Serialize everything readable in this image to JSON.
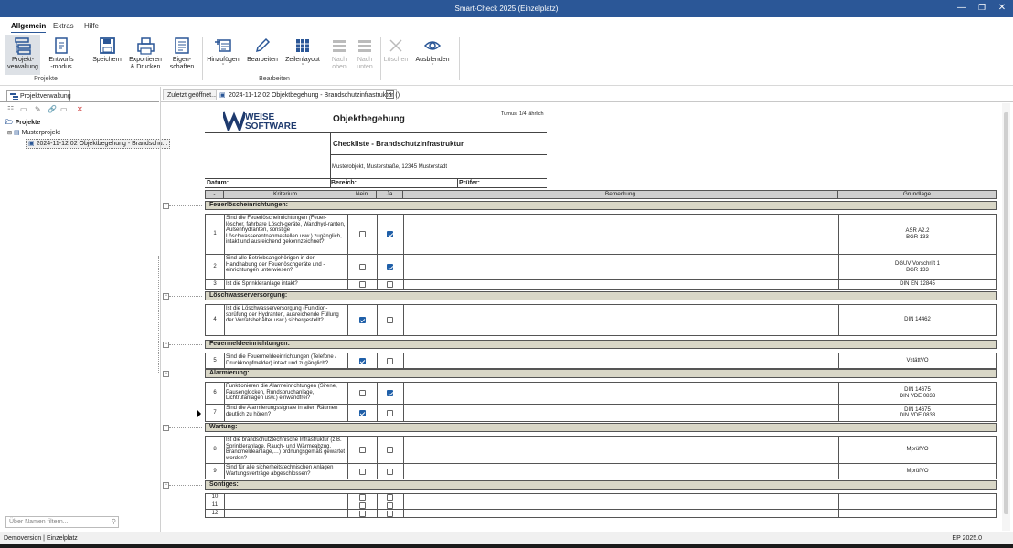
{
  "window": {
    "title": "Smart-Check 2025 (Einzelplatz)"
  },
  "ribbon": {
    "tabs": [
      "Allgemein",
      "Extras",
      "Hilfe"
    ],
    "buttons": {
      "projektverwaltung": "Projekt-\nverwaltung",
      "entwurfsmodus": "Entwurfs\n-modus",
      "speichern": "Speichern",
      "exportieren": "Exportieren\n& Drucken",
      "eigenschaften": "Eigen-\nschaften",
      "hinzufuegen": "Hinzufügen",
      "bearbeiten": "Bearbeiten",
      "zeilenlayout": "Zeilenlayout",
      "nach_oben": "Nach\noben",
      "nach_unten": "Nach\nunten",
      "loeschen": "Löschen",
      "ausblenden": "Ausblenden"
    },
    "groups": {
      "projekte": "Projekte",
      "bearbeiten": "Bearbeiten"
    }
  },
  "left_panel": {
    "tab": "Projektverwaltung",
    "tree": {
      "root": "Projekte",
      "project": "Musterprojekt",
      "item": "2024-11-12 02 Objektbegehung - Brandschu..."
    },
    "filter_placeholder": "Über Namen filtern..."
  },
  "doc_tabs": {
    "recent": "Zuletzt geöffnet...",
    "active": "2024-11-12 02 Objektbegehung - Brandschutzinfrastruktur ()"
  },
  "document": {
    "logo_line1": "WEISE",
    "logo_line2": "SOFTWARE",
    "title": "Objektbegehung",
    "turnus": "Turnus: 1/4 jährlich",
    "checklist": "Checkliste - Brandschutzinfrastruktur",
    "address": "Musterobjekt, Musterstraße, 12345 Musterstadt",
    "datum": "Datum:",
    "bereich": "Bereich:",
    "pruefer": "Prüfer:",
    "columns": {
      "num": "-",
      "kriterium": "Kriterium",
      "nein": "Nein",
      "ja": "Ja",
      "bemerkung": "Bemerkung",
      "grundlage": "Grundlage"
    },
    "sections": [
      {
        "title": "Feuerlöscheinrichtungen:",
        "rows": [
          {
            "num": "1",
            "text": "Sind die Feuerlöscheinrichtungen (Feuer-löscher, fahrbare Lösch-geräte, Wandhyd-ranten, Außenhydranten, sonstige Löschwasserentnahmestellen usw.) zugänglich, intakt und ausreichend gekennzeichnet?",
            "nein": false,
            "ja": true,
            "grundlage": "ASR A2.2\nBGR 133"
          },
          {
            "num": "2",
            "text": "Sind alle Betriebsangehörigen in der Handhabung der Feuerlöschgeräte und -einrichtungen unterwiesen?",
            "nein": false,
            "ja": true,
            "grundlage": "DGUV Vorschrift 1\nBGR 133"
          },
          {
            "num": "3",
            "text": "Ist die Sprinkleranlage intakt?",
            "nein": false,
            "ja": false,
            "grundlage": "DIN EN 12845"
          }
        ]
      },
      {
        "title": "Löschwasserversorgung:",
        "rows": [
          {
            "num": "4",
            "text": "Ist die Löschwasserversorgung (Funktion-sprüfung der Hydranten, ausreichende Füllung der Vorratsbehälter usw.) sichergestellt?",
            "nein": true,
            "ja": false,
            "grundlage": "DIN 14462"
          }
        ]
      },
      {
        "title": "Feuermeldeeinrichtungen:",
        "rows": [
          {
            "num": "5",
            "text": "Sind die Feuermeldeeinrichtungen (Telefone / Druckknopfmelder) intakt und zugänglich?",
            "nein": true,
            "ja": false,
            "grundlage": "VstättVO"
          }
        ]
      },
      {
        "title": "Alarmierung:",
        "rows": [
          {
            "num": "6",
            "text": "Funktionieren die Alarmeinrichtungen (Sirene, Pausenglocken, Rundspruchanlage, Lichtrufanlagen usw.) einwandfrei?",
            "nein": false,
            "ja": true,
            "grundlage": "DIN 14675\nDIN VDE 0833"
          },
          {
            "num": "7",
            "text": "Sind die Alarmierungssignale in allen Räumen deutlich zu hören?",
            "nein": true,
            "ja": false,
            "grundlage": "DIN 14675\nDIN VDE 0833"
          }
        ]
      },
      {
        "title": "Wartung:",
        "rows": [
          {
            "num": "8",
            "text": "Ist die brandschutztechnische Infrastruktur (z.B. Sprinkleranlage, Rauch- und Wärmeabzug, Brandmeldeanlage,…) ordnungsgemäß gewartet worden?",
            "nein": false,
            "ja": false,
            "grundlage": "MprüfVO"
          },
          {
            "num": "9",
            "text": "Sind für alle sicherheitstechnischen Anlagen Wartungsverträge abgeschlossen?",
            "nein": false,
            "ja": false,
            "grundlage": "MprüfVO"
          }
        ]
      },
      {
        "title": "Sontiges:",
        "rows": [
          {
            "num": "10",
            "text": "",
            "nein": false,
            "ja": false,
            "grundlage": ""
          },
          {
            "num": "11",
            "text": "",
            "nein": false,
            "ja": false,
            "grundlage": ""
          },
          {
            "num": "12",
            "text": "",
            "nein": false,
            "ja": false,
            "grundlage": ""
          }
        ]
      }
    ]
  },
  "status": {
    "left": "Demoversion  |  Einzelplatz",
    "right": "EP 2025.0"
  }
}
